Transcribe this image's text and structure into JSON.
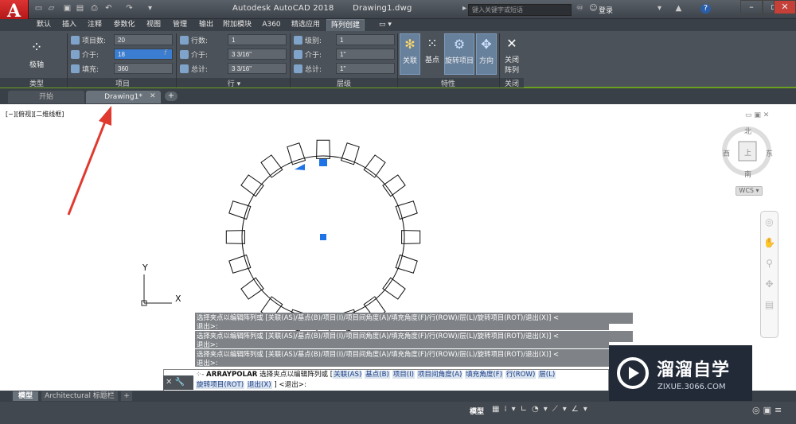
{
  "app": {
    "logo_letter": "A",
    "title": "Autodesk AutoCAD 2018",
    "drawing_name": "Drawing1.dwg",
    "search_placeholder": "键入关键字或短语",
    "login": "登录",
    "help": "?"
  },
  "ribbon_tabs": [
    "默认",
    "插入",
    "注释",
    "参数化",
    "视图",
    "管理",
    "输出",
    "附加模块",
    "A360",
    "精选应用",
    "阵列创建"
  ],
  "ribbon": {
    "type_button": "极轴",
    "type_panel": "类型",
    "items": {
      "count_label": "项目数:",
      "count_value": "20",
      "between_label": "介于:",
      "between_value": "18",
      "fill_label": "填充:",
      "fill_value": "360",
      "panel": "项目"
    },
    "rows": {
      "count_label": "行数:",
      "count_value": "1",
      "between_label": "介于:",
      "between_value": "3 3/16\"",
      "total_label": "总计:",
      "total_value": "3 3/16\"",
      "panel": "行 ▾"
    },
    "levels": {
      "count_label": "级别:",
      "count_value": "1",
      "between_label": "介于:",
      "between_value": "1\"",
      "total_label": "总计:",
      "total_value": "1\"",
      "panel": "层级"
    },
    "props": {
      "assoc": "关联",
      "basepoint": "基点",
      "rotate": "旋转项目",
      "direction": "方向",
      "panel": "特性"
    },
    "close": {
      "label1": "关闭",
      "label2": "阵列",
      "panel": "关闭"
    }
  },
  "doc_tabs": [
    "开始",
    "Drawing1*"
  ],
  "viewport_label": "[−][俯视][二维线框]",
  "viewcube": {
    "n": "北",
    "s": "南",
    "w": "西",
    "e": "东",
    "wcs": "WCS"
  },
  "ucs": {
    "x": "X",
    "y": "Y"
  },
  "cmd_history": [
    "选择夹点以编辑阵列或 [关联(AS)/基点(B)/项目(I)/项目间角度(A)/填充角度(F)/行(ROW)/层(L)/旋转项目(ROT)/退出(X)] <",
    "退出>:",
    "选择夹点以编辑阵列或 [关联(AS)/基点(B)/项目(I)/项目间角度(A)/填充角度(F)/行(ROW)/层(L)/旋转项目(ROT)/退出(X)] <",
    "退出>:",
    "选择夹点以编辑阵列或 [关联(AS)/基点(B)/项目(I)/项目间角度(A)/填充角度(F)/行(ROW)/层(L)/旋转项目(ROT)/退出(X)] <",
    "退出>:"
  ],
  "cmd": {
    "name": "ARRAYPOLAR",
    "prompt": "选择夹点以编辑阵列或 [",
    "opts": [
      "关联(AS)",
      "基点(B)",
      "项目(I)",
      "项目间角度(A)",
      "填充角度(F)",
      "行(ROW)",
      "层(L)"
    ],
    "line2_opts": [
      "旋转项目(ROT)",
      "退出(X)"
    ],
    "line2_tail": "] <退出>:"
  },
  "layout_tabs": [
    "模型",
    "Architectural 标题栏",
    "+"
  ],
  "status": {
    "model": "模型"
  },
  "watermark": {
    "cn": "溜溜自学",
    "en": "ZIXUE.3066.COM"
  },
  "colors": {
    "accent": "#2a7be4",
    "annotation_arrow": "#e03a2f"
  }
}
